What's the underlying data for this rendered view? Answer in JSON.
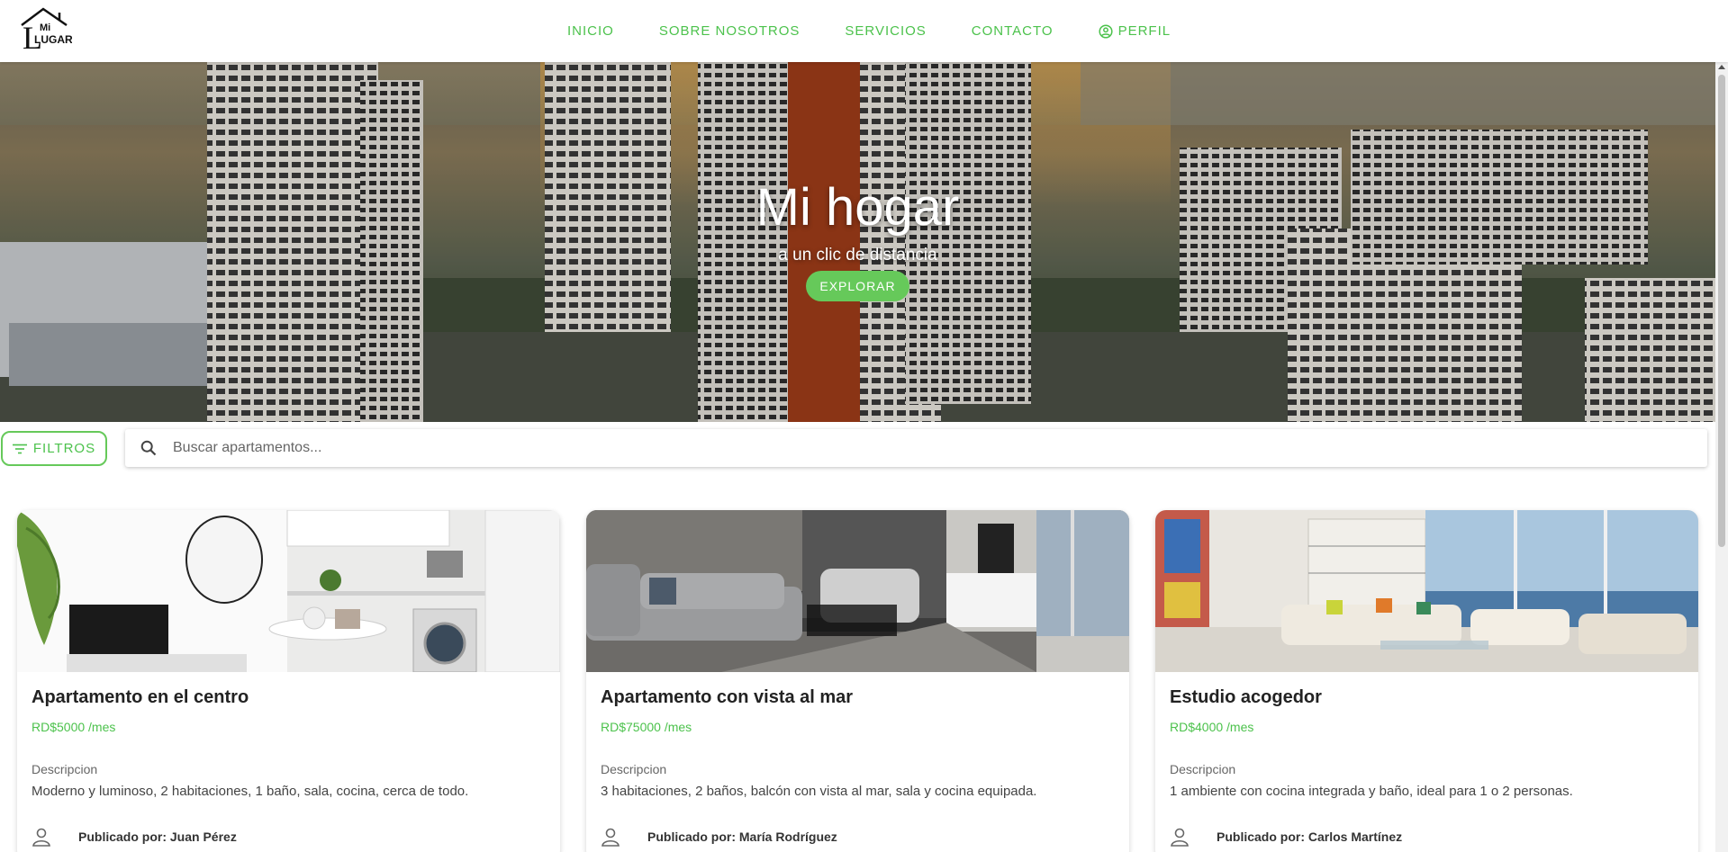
{
  "colors": {
    "accent": "#4cc24c",
    "button": "#66c95a"
  },
  "logo": {
    "line1": "Mi",
    "line2": "LUGAR"
  },
  "nav": [
    {
      "label": "INICIO",
      "icon": ""
    },
    {
      "label": "SOBRE NOSOTROS",
      "icon": ""
    },
    {
      "label": "SERVICIOS",
      "icon": ""
    },
    {
      "label": "CONTACTO",
      "icon": ""
    },
    {
      "label": "PERFIL",
      "icon": "user-circle-icon"
    }
  ],
  "hero": {
    "title": "Mi hogar",
    "subtitle": "a un clic de distancia",
    "button": "EXPLORAR"
  },
  "filters": {
    "label": "FILTROS",
    "icon": "filter-lines-icon"
  },
  "search": {
    "placeholder": "Buscar apartamentos...",
    "icon": "search-icon"
  },
  "listings": [
    {
      "title": "Apartamento en el centro",
      "price": "RD$5000 /mes",
      "desc_label": "Descripcion",
      "description": "Moderno y luminoso, 2 habitaciones, 1 baño, sala, cocina, cerca de todo.",
      "author": "Publicado por: Juan Pérez"
    },
    {
      "title": "Apartamento con vista al mar",
      "price": "RD$75000 /mes",
      "desc_label": "Descripcion",
      "description": "3 habitaciones, 2 baños, balcón con vista al mar, sala y cocina equipada.",
      "author": "Publicado por: María Rodríguez"
    },
    {
      "title": "Estudio acogedor",
      "price": "RD$4000 /mes",
      "desc_label": "Descripcion",
      "description": "1 ambiente con cocina integrada y baño, ideal para 1 o 2 personas.",
      "author": "Publicado por: Carlos Martínez"
    }
  ]
}
